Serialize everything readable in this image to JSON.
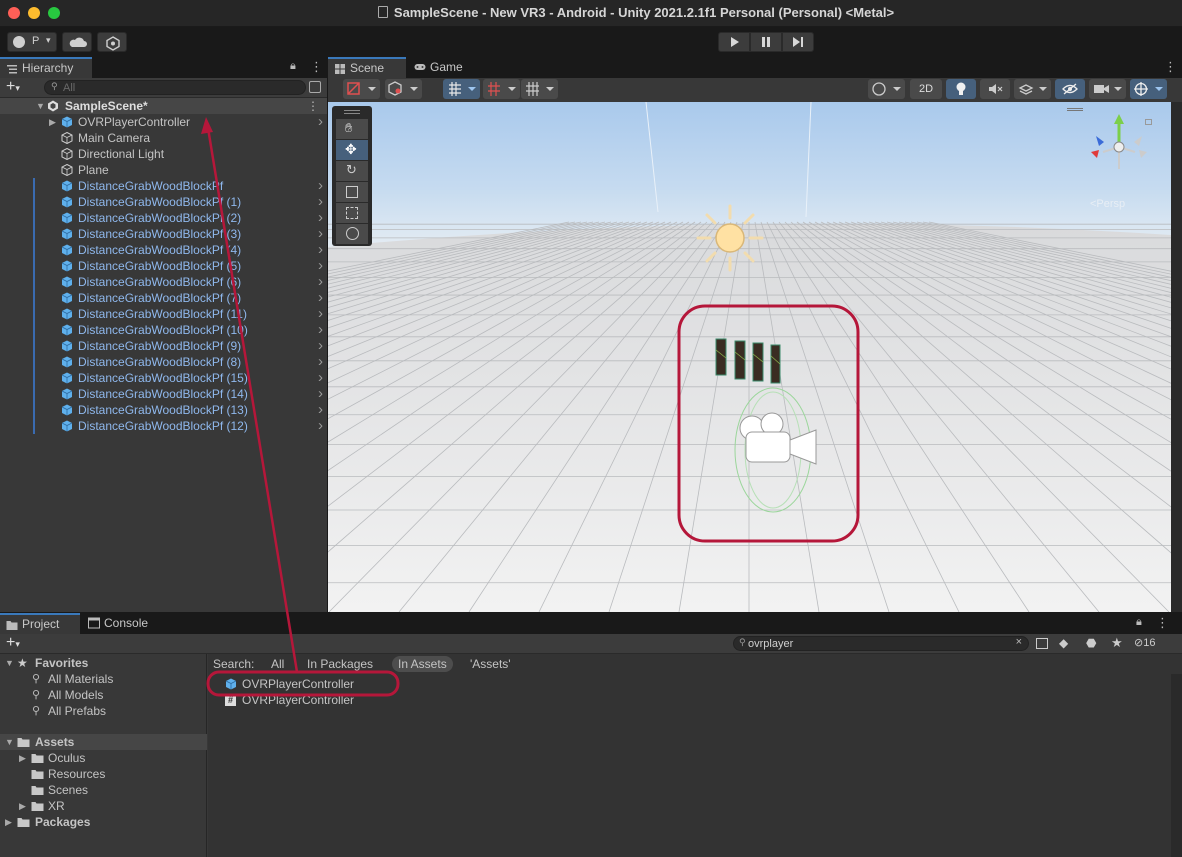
{
  "window": {
    "title": "SampleScene - New VR3 - Android - Unity 2021.2.1f1 Personal (Personal) <Metal>"
  },
  "toolbar": {
    "account_label": "P",
    "cloud_icon": "cloud-icon",
    "collab_icon": "collab-icon"
  },
  "hierarchy": {
    "tab_label": "Hierarchy",
    "search_placeholder": "All",
    "scene_name": "SampleScene*",
    "items": [
      {
        "label": "OVRPlayerController",
        "prefab": true,
        "blue": false,
        "arrow": true
      },
      {
        "label": "Main Camera",
        "prefab": false,
        "blue": false
      },
      {
        "label": "Directional Light",
        "prefab": false,
        "blue": false
      },
      {
        "label": "Plane",
        "prefab": false,
        "blue": false
      },
      {
        "label": "DistanceGrabWoodBlockPf",
        "prefab": true,
        "blue": true
      },
      {
        "label": "DistanceGrabWoodBlockPf (1)",
        "prefab": true,
        "blue": true
      },
      {
        "label": "DistanceGrabWoodBlockPf (2)",
        "prefab": true,
        "blue": true
      },
      {
        "label": "DistanceGrabWoodBlockPf (3)",
        "prefab": true,
        "blue": true
      },
      {
        "label": "DistanceGrabWoodBlockPf (4)",
        "prefab": true,
        "blue": true
      },
      {
        "label": "DistanceGrabWoodBlockPf (5)",
        "prefab": true,
        "blue": true
      },
      {
        "label": "DistanceGrabWoodBlockPf (6)",
        "prefab": true,
        "blue": true
      },
      {
        "label": "DistanceGrabWoodBlockPf (7)",
        "prefab": true,
        "blue": true
      },
      {
        "label": "DistanceGrabWoodBlockPf (11)",
        "prefab": true,
        "blue": true
      },
      {
        "label": "DistanceGrabWoodBlockPf (10)",
        "prefab": true,
        "blue": true
      },
      {
        "label": "DistanceGrabWoodBlockPf (9)",
        "prefab": true,
        "blue": true
      },
      {
        "label": "DistanceGrabWoodBlockPf (8)",
        "prefab": true,
        "blue": true
      },
      {
        "label": "DistanceGrabWoodBlockPf (15)",
        "prefab": true,
        "blue": true
      },
      {
        "label": "DistanceGrabWoodBlockPf (14)",
        "prefab": true,
        "blue": true
      },
      {
        "label": "DistanceGrabWoodBlockPf (13)",
        "prefab": true,
        "blue": true
      },
      {
        "label": "DistanceGrabWoodBlockPf (12)",
        "prefab": true,
        "blue": true
      }
    ]
  },
  "scene": {
    "tabs": [
      {
        "label": "Scene",
        "active": true
      },
      {
        "label": "Game",
        "active": false
      }
    ],
    "mode_2d": "2D",
    "persp_label": "<Persp"
  },
  "project": {
    "tabs": [
      {
        "label": "Project",
        "active": true
      },
      {
        "label": "Console",
        "active": false
      }
    ],
    "search_value": "ovrplayer",
    "hidden_count": "16",
    "favorites_label": "Favorites",
    "favorites": [
      "All Materials",
      "All Models",
      "All Prefabs"
    ],
    "assets_label": "Assets",
    "assets": [
      "Oculus",
      "Resources",
      "Scenes",
      "XR"
    ],
    "packages_label": "Packages",
    "search_bar": {
      "label": "Search:",
      "scopes": [
        "All",
        "In Packages",
        "In Assets",
        "'Assets'"
      ],
      "active_scope": "In Assets"
    },
    "results": [
      {
        "label": "OVRPlayerController",
        "kind": "prefab"
      },
      {
        "label": "OVRPlayerController",
        "kind": "script"
      }
    ]
  },
  "colors": {
    "accent": "#3a79bb",
    "prefab_blue": "#8fb8ed",
    "annotation": "#b5173a"
  }
}
